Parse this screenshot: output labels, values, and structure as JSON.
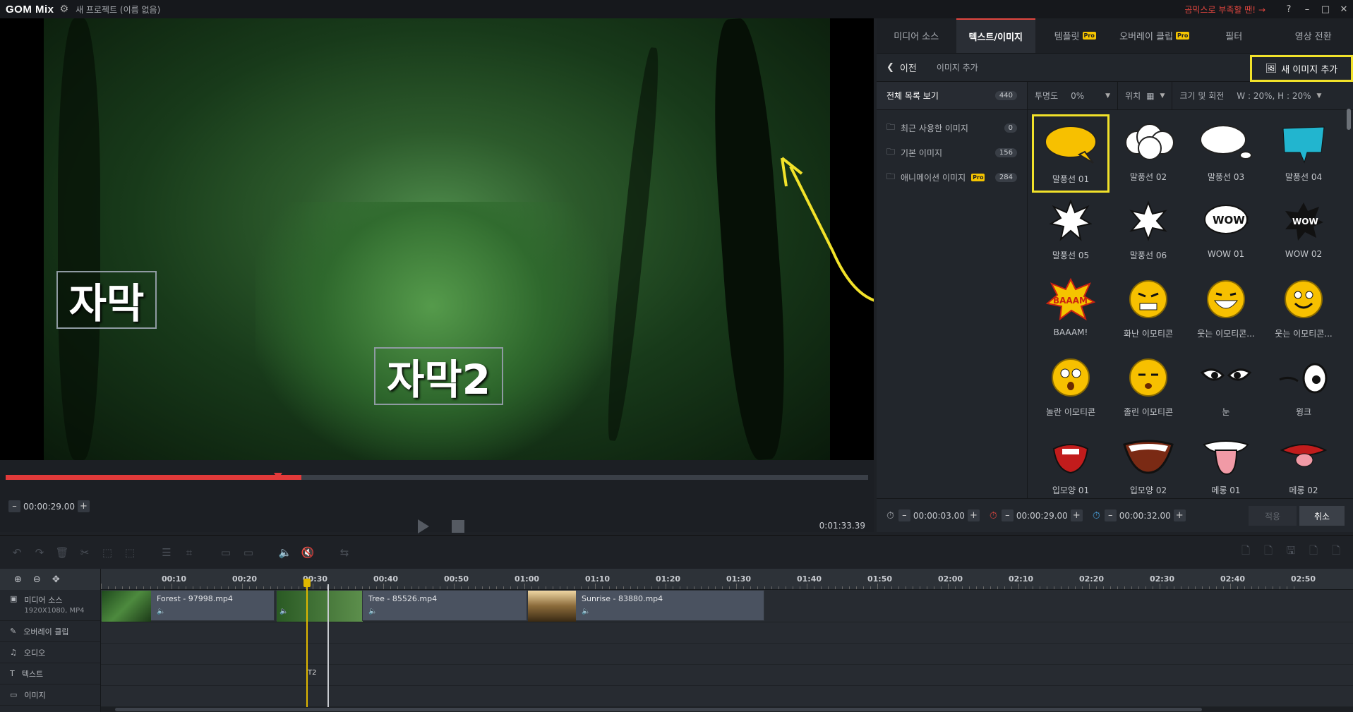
{
  "titlebar": {
    "logo": "GOM Mix",
    "project": "새 프로젝트 (이름 없음)",
    "promo": "곰믹스로 부족할 땐!",
    "help": "?",
    "min": "–",
    "max": "□",
    "close": "✕"
  },
  "preview": {
    "subtitle1": "자막",
    "subtitle2": "자막2",
    "current_time": "00:00:29.00",
    "duration": "0:01:33.39",
    "progress": 0.29
  },
  "panel": {
    "tabs": [
      {
        "label": "미디어 소스",
        "pro": false
      },
      {
        "label": "텍스트/이미지",
        "pro": false,
        "active": true
      },
      {
        "label": "템플릿",
        "pro": true
      },
      {
        "label": "오버레이 클립",
        "pro": true
      },
      {
        "label": "필터",
        "pro": false
      },
      {
        "label": "영상 전환",
        "pro": false
      }
    ],
    "pro_badge": "Pro",
    "back_label": "이전",
    "section_label": "이미지 추가",
    "new_image_btn": "새 이미지 추가",
    "all_list": {
      "label": "전체 목록 보기",
      "count": "440"
    },
    "categories": [
      {
        "label": "최근 사용한 이미지",
        "count": "0"
      },
      {
        "label": "기본 이미지",
        "count": "156"
      },
      {
        "label": "애니메이션 이미지",
        "count": "284",
        "pro": true
      }
    ],
    "options": {
      "opacity_label": "투명도",
      "opacity_value": "0%",
      "position_label": "위치",
      "size_label": "크기 및 회전",
      "size_value": "W : 20%, H : 20%"
    },
    "images": [
      "말풍선 01",
      "말풍선 02",
      "말풍선 03",
      "말풍선 04",
      "말풍선 05",
      "말풍선 06",
      "WOW 01",
      "WOW 02",
      "BAAAM!",
      "화난 이모티콘",
      "웃는 이모티콘...",
      "웃는 이모티콘...",
      "놀란 이모티콘",
      "졸린 이모티콘",
      "눈",
      "윙크",
      "입모양 01",
      "입모양 02",
      "메롱 01",
      "메롱 02"
    ],
    "start_time": "00:00:03.00",
    "end_time": "00:00:29.00",
    "duration_time": "00:00:32.00",
    "apply": "적용",
    "cancel": "취소"
  },
  "timeline": {
    "ticks": [
      "00:10",
      "00:20",
      "00:30",
      "00:40",
      "00:50",
      "01:00",
      "01:10",
      "01:20",
      "01:30",
      "01:40",
      "01:50",
      "02:00",
      "02:10",
      "02:20",
      "02:30",
      "02:40",
      "02:50"
    ],
    "tracks": {
      "media": "미디어 소스",
      "media_info": "1920X1080, MP4",
      "overlay": "오버레이 클립",
      "audio": "오디오",
      "text": "텍스트",
      "image": "이미지"
    },
    "clips": [
      "Forest - 97998.mp4",
      "Tree - 85526.mp4",
      "Sunrise - 83880.mp4"
    ],
    "text_clip": "T2"
  }
}
